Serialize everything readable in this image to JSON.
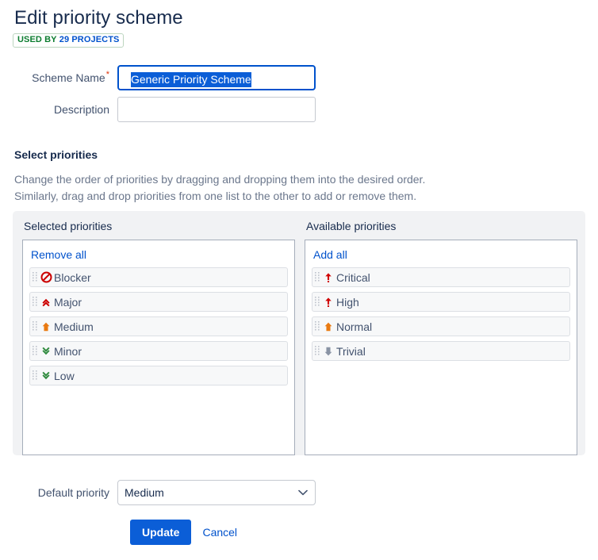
{
  "header": {
    "title": "Edit priority scheme",
    "badge": {
      "prefix": "USED BY",
      "count": "29",
      "suffix": "PROJECTS",
      "full_text": "USED BY 29 PROJECTS",
      "border_color": "#bcd5bf",
      "green": "#0c7d2f",
      "blue": "#0052cc"
    }
  },
  "form": {
    "scheme_name": {
      "label": "Scheme Name",
      "required_marker": "*",
      "value": "Generic Priority Scheme",
      "placeholder": "",
      "focused": true,
      "text_selected": true,
      "focus_color": "#0052cc",
      "selection_color": "#0b5ed7"
    },
    "description": {
      "label": "Description",
      "value": "",
      "placeholder": ""
    }
  },
  "section": {
    "title": "Select priorities",
    "description_line1": "Change the order of priorities by dragging and dropping them into the desired order.",
    "description_line2": "Similarly, drag and drop priorities from one list to the other to add or remove them."
  },
  "selected_priorities": {
    "title": "Selected priorities",
    "action_label": "Remove all",
    "items": [
      {
        "label": "Blocker",
        "icon": "blocker-icon",
        "color": "#cc0000"
      },
      {
        "label": "Major",
        "icon": "chevron-double-up-icon",
        "color": "#cc0000"
      },
      {
        "label": "Medium",
        "icon": "arrow-up-icon",
        "color": "#e97a11"
      },
      {
        "label": "Minor",
        "icon": "chevron-double-down-icon",
        "color": "#2f8a3e"
      },
      {
        "label": "Low",
        "icon": "chevron-double-down-icon",
        "color": "#2f8a3e"
      }
    ]
  },
  "available_priorities": {
    "title": "Available priorities",
    "action_label": "Add all",
    "items": [
      {
        "label": "Critical",
        "icon": "arrow-up-alert-icon",
        "color": "#d00000"
      },
      {
        "label": "High",
        "icon": "arrow-up-alert-icon",
        "color": "#d00000"
      },
      {
        "label": "Normal",
        "icon": "arrow-up-icon",
        "color": "#e97a11"
      },
      {
        "label": "Trivial",
        "icon": "arrow-down-icon",
        "color": "#8993a4"
      }
    ]
  },
  "footer": {
    "default_priority": {
      "label": "Default priority",
      "value": "Medium",
      "options": [
        "Blocker",
        "Major",
        "Medium",
        "Minor",
        "Low"
      ]
    },
    "update_label": "Update",
    "cancel_label": "Cancel",
    "primary_color": "#0b5ed7",
    "link_color": "#0052cc"
  }
}
